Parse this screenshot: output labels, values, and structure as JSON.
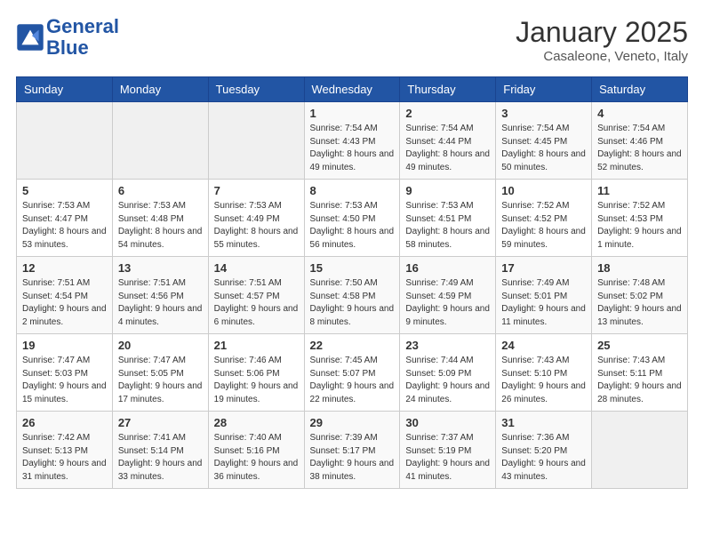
{
  "header": {
    "logo_line1": "General",
    "logo_line2": "Blue",
    "month": "January 2025",
    "location": "Casaleone, Veneto, Italy"
  },
  "weekdays": [
    "Sunday",
    "Monday",
    "Tuesday",
    "Wednesday",
    "Thursday",
    "Friday",
    "Saturday"
  ],
  "weeks": [
    [
      {
        "day": "",
        "sunrise": "",
        "sunset": "",
        "daylight": ""
      },
      {
        "day": "",
        "sunrise": "",
        "sunset": "",
        "daylight": ""
      },
      {
        "day": "",
        "sunrise": "",
        "sunset": "",
        "daylight": ""
      },
      {
        "day": "1",
        "sunrise": "Sunrise: 7:54 AM",
        "sunset": "Sunset: 4:43 PM",
        "daylight": "Daylight: 8 hours and 49 minutes."
      },
      {
        "day": "2",
        "sunrise": "Sunrise: 7:54 AM",
        "sunset": "Sunset: 4:44 PM",
        "daylight": "Daylight: 8 hours and 49 minutes."
      },
      {
        "day": "3",
        "sunrise": "Sunrise: 7:54 AM",
        "sunset": "Sunset: 4:45 PM",
        "daylight": "Daylight: 8 hours and 50 minutes."
      },
      {
        "day": "4",
        "sunrise": "Sunrise: 7:54 AM",
        "sunset": "Sunset: 4:46 PM",
        "daylight": "Daylight: 8 hours and 52 minutes."
      }
    ],
    [
      {
        "day": "5",
        "sunrise": "Sunrise: 7:53 AM",
        "sunset": "Sunset: 4:47 PM",
        "daylight": "Daylight: 8 hours and 53 minutes."
      },
      {
        "day": "6",
        "sunrise": "Sunrise: 7:53 AM",
        "sunset": "Sunset: 4:48 PM",
        "daylight": "Daylight: 8 hours and 54 minutes."
      },
      {
        "day": "7",
        "sunrise": "Sunrise: 7:53 AM",
        "sunset": "Sunset: 4:49 PM",
        "daylight": "Daylight: 8 hours and 55 minutes."
      },
      {
        "day": "8",
        "sunrise": "Sunrise: 7:53 AM",
        "sunset": "Sunset: 4:50 PM",
        "daylight": "Daylight: 8 hours and 56 minutes."
      },
      {
        "day": "9",
        "sunrise": "Sunrise: 7:53 AM",
        "sunset": "Sunset: 4:51 PM",
        "daylight": "Daylight: 8 hours and 58 minutes."
      },
      {
        "day": "10",
        "sunrise": "Sunrise: 7:52 AM",
        "sunset": "Sunset: 4:52 PM",
        "daylight": "Daylight: 8 hours and 59 minutes."
      },
      {
        "day": "11",
        "sunrise": "Sunrise: 7:52 AM",
        "sunset": "Sunset: 4:53 PM",
        "daylight": "Daylight: 9 hours and 1 minute."
      }
    ],
    [
      {
        "day": "12",
        "sunrise": "Sunrise: 7:51 AM",
        "sunset": "Sunset: 4:54 PM",
        "daylight": "Daylight: 9 hours and 2 minutes."
      },
      {
        "day": "13",
        "sunrise": "Sunrise: 7:51 AM",
        "sunset": "Sunset: 4:56 PM",
        "daylight": "Daylight: 9 hours and 4 minutes."
      },
      {
        "day": "14",
        "sunrise": "Sunrise: 7:51 AM",
        "sunset": "Sunset: 4:57 PM",
        "daylight": "Daylight: 9 hours and 6 minutes."
      },
      {
        "day": "15",
        "sunrise": "Sunrise: 7:50 AM",
        "sunset": "Sunset: 4:58 PM",
        "daylight": "Daylight: 9 hours and 8 minutes."
      },
      {
        "day": "16",
        "sunrise": "Sunrise: 7:49 AM",
        "sunset": "Sunset: 4:59 PM",
        "daylight": "Daylight: 9 hours and 9 minutes."
      },
      {
        "day": "17",
        "sunrise": "Sunrise: 7:49 AM",
        "sunset": "Sunset: 5:01 PM",
        "daylight": "Daylight: 9 hours and 11 minutes."
      },
      {
        "day": "18",
        "sunrise": "Sunrise: 7:48 AM",
        "sunset": "Sunset: 5:02 PM",
        "daylight": "Daylight: 9 hours and 13 minutes."
      }
    ],
    [
      {
        "day": "19",
        "sunrise": "Sunrise: 7:47 AM",
        "sunset": "Sunset: 5:03 PM",
        "daylight": "Daylight: 9 hours and 15 minutes."
      },
      {
        "day": "20",
        "sunrise": "Sunrise: 7:47 AM",
        "sunset": "Sunset: 5:05 PM",
        "daylight": "Daylight: 9 hours and 17 minutes."
      },
      {
        "day": "21",
        "sunrise": "Sunrise: 7:46 AM",
        "sunset": "Sunset: 5:06 PM",
        "daylight": "Daylight: 9 hours and 19 minutes."
      },
      {
        "day": "22",
        "sunrise": "Sunrise: 7:45 AM",
        "sunset": "Sunset: 5:07 PM",
        "daylight": "Daylight: 9 hours and 22 minutes."
      },
      {
        "day": "23",
        "sunrise": "Sunrise: 7:44 AM",
        "sunset": "Sunset: 5:09 PM",
        "daylight": "Daylight: 9 hours and 24 minutes."
      },
      {
        "day": "24",
        "sunrise": "Sunrise: 7:43 AM",
        "sunset": "Sunset: 5:10 PM",
        "daylight": "Daylight: 9 hours and 26 minutes."
      },
      {
        "day": "25",
        "sunrise": "Sunrise: 7:43 AM",
        "sunset": "Sunset: 5:11 PM",
        "daylight": "Daylight: 9 hours and 28 minutes."
      }
    ],
    [
      {
        "day": "26",
        "sunrise": "Sunrise: 7:42 AM",
        "sunset": "Sunset: 5:13 PM",
        "daylight": "Daylight: 9 hours and 31 minutes."
      },
      {
        "day": "27",
        "sunrise": "Sunrise: 7:41 AM",
        "sunset": "Sunset: 5:14 PM",
        "daylight": "Daylight: 9 hours and 33 minutes."
      },
      {
        "day": "28",
        "sunrise": "Sunrise: 7:40 AM",
        "sunset": "Sunset: 5:16 PM",
        "daylight": "Daylight: 9 hours and 36 minutes."
      },
      {
        "day": "29",
        "sunrise": "Sunrise: 7:39 AM",
        "sunset": "Sunset: 5:17 PM",
        "daylight": "Daylight: 9 hours and 38 minutes."
      },
      {
        "day": "30",
        "sunrise": "Sunrise: 7:37 AM",
        "sunset": "Sunset: 5:19 PM",
        "daylight": "Daylight: 9 hours and 41 minutes."
      },
      {
        "day": "31",
        "sunrise": "Sunrise: 7:36 AM",
        "sunset": "Sunset: 5:20 PM",
        "daylight": "Daylight: 9 hours and 43 minutes."
      },
      {
        "day": "",
        "sunrise": "",
        "sunset": "",
        "daylight": ""
      }
    ]
  ]
}
